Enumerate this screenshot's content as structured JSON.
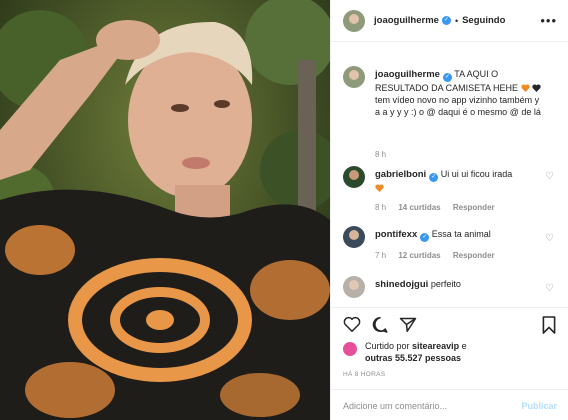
{
  "header": {
    "username": "joaoguilherme",
    "separator": "•",
    "follow_label": "Seguindo",
    "more_icon": "more-options-icon"
  },
  "caption": {
    "username": "joaoguilherme",
    "text_1": "TA AQUI O RESULTADO DA CAMISETA HEHE",
    "text_2": "tem vídeo novo no app vizinho também y a a y y y :) o @ daqui é o mesmo @ de lá",
    "time": "8 h"
  },
  "comments": [
    {
      "username": "gabrielboni",
      "text": "Ui ui ui ficou irada",
      "time": "8 h",
      "likes": "14 curtidas",
      "reply": "Responder"
    },
    {
      "username": "pontifexx",
      "text": "Essa ta animal",
      "time": "7 h",
      "likes": "12 curtidas",
      "reply": "Responder"
    },
    {
      "username": "shinedojgui",
      "text": "perfeito"
    }
  ],
  "likes": {
    "prefix": "Curtido por",
    "user": "siteareavip",
    "middle": "e",
    "others": "outras 55.527 pessoas"
  },
  "timestamp": "HÁ 8 HORAS",
  "comment_box": {
    "placeholder": "Adicione um comentário...",
    "publish_label": "Publicar"
  },
  "colors": {
    "accent": "#3897f0",
    "heart_orange": "#f08a24",
    "heart_black": "#262626",
    "publish_disabled": "#b2dffc"
  }
}
